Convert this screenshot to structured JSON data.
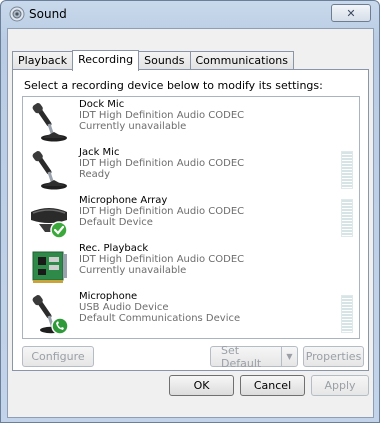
{
  "window": {
    "title": "Sound",
    "close_glyph": "✕"
  },
  "tabs": [
    {
      "label": "Playback",
      "active": false
    },
    {
      "label": "Recording",
      "active": true
    },
    {
      "label": "Sounds",
      "active": false
    },
    {
      "label": "Communications",
      "active": false
    }
  ],
  "panel": {
    "instruction": "Select a recording device below to modify its settings:"
  },
  "devices": [
    {
      "name": "Dock Mic",
      "driver": "IDT High Definition Audio CODEC",
      "status": "Currently unavailable",
      "icon": "microphone-icon",
      "status_icon": "none",
      "has_meter": false
    },
    {
      "name": "Jack Mic",
      "driver": "IDT High Definition Audio CODEC",
      "status": "Ready",
      "icon": "microphone-icon",
      "status_icon": "none",
      "has_meter": true
    },
    {
      "name": "Microphone Array",
      "driver": "IDT High Definition Audio CODEC",
      "status": "Default Device",
      "icon": "microphone-array-icon",
      "status_icon": "default-check-icon",
      "has_meter": true
    },
    {
      "name": "Rec. Playback",
      "driver": "IDT High Definition Audio CODEC",
      "status": "Currently unavailable",
      "icon": "circuit-board-icon",
      "status_icon": "none",
      "has_meter": false
    },
    {
      "name": "Microphone",
      "driver": "USB Audio Device",
      "status": "Default Communications Device",
      "icon": "microphone-icon",
      "status_icon": "communications-phone-icon",
      "has_meter": true
    }
  ],
  "buttons": {
    "configure": "Configure",
    "set_default": "Set Default",
    "set_default_arrow": "▼",
    "properties": "Properties",
    "ok": "OK",
    "cancel": "Cancel",
    "apply": "Apply"
  },
  "colors": {
    "default_check": "#3aa83a",
    "phone_badge": "#2f9a3a"
  }
}
